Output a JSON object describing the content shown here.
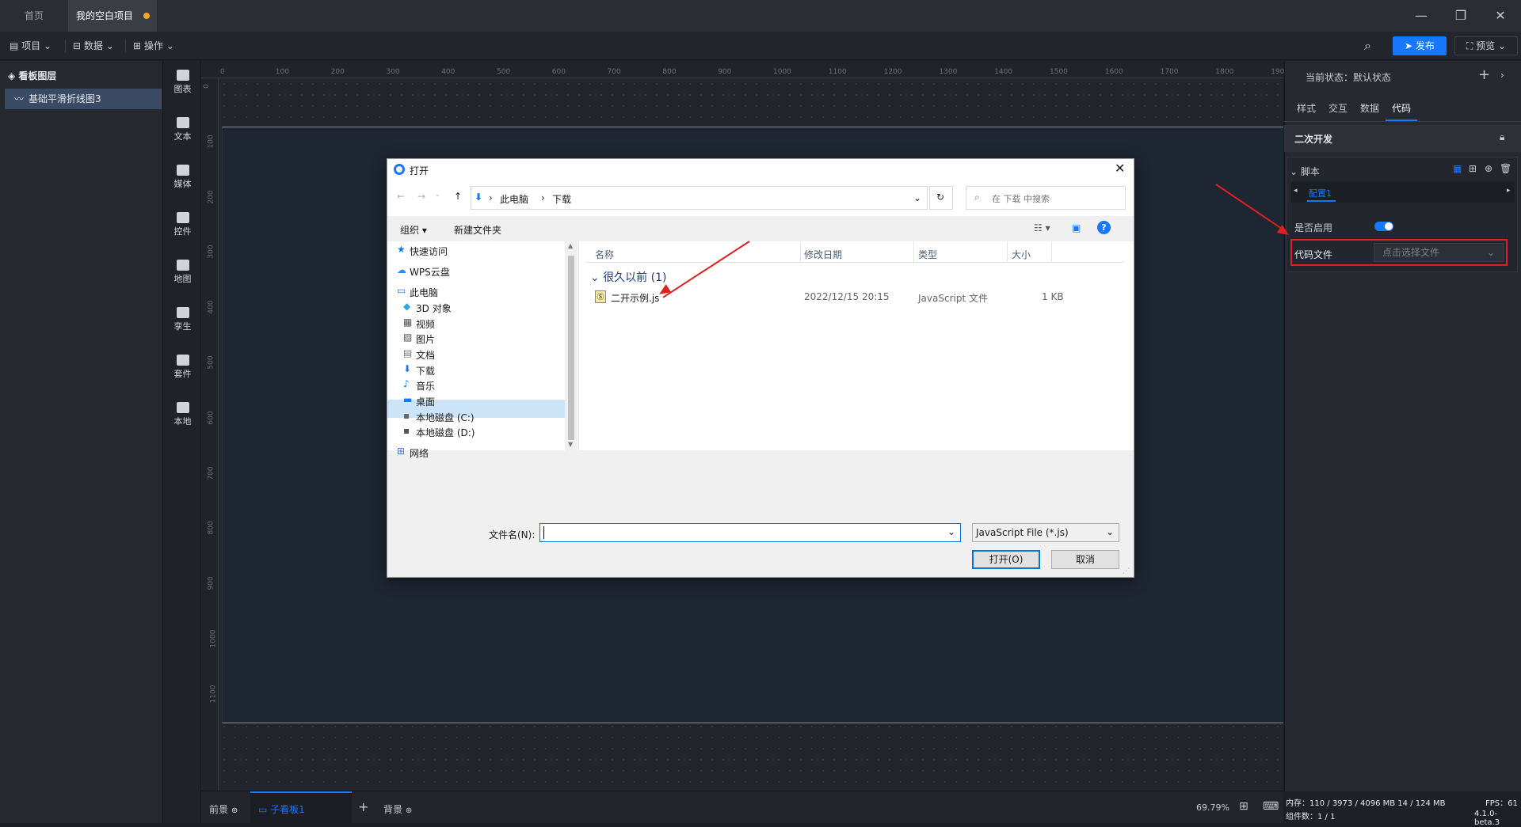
{
  "tabs": [
    {
      "label": "首页"
    },
    {
      "label": "我的空白项目"
    }
  ],
  "window_controls": {
    "minimize": "—",
    "restore": "❐",
    "close": "✕"
  },
  "menu": {
    "project": "项目",
    "data": "数据",
    "operate": "操作"
  },
  "header": {
    "publish": "发布",
    "preview": "预览"
  },
  "layers": {
    "title": "看板图层",
    "items": [
      {
        "label": "基础平滑折线图3"
      }
    ]
  },
  "rail": [
    {
      "label": "图表",
      "icon": "chart-icon"
    },
    {
      "label": "文本",
      "icon": "text-icon"
    },
    {
      "label": "媒体",
      "icon": "media-icon"
    },
    {
      "label": "控件",
      "icon": "control-icon"
    },
    {
      "label": "地图",
      "icon": "map-icon"
    },
    {
      "label": "孪生",
      "icon": "twin-icon"
    },
    {
      "label": "套件",
      "icon": "kit-icon"
    },
    {
      "label": "本地",
      "icon": "local-icon"
    }
  ],
  "ruler": {
    "h_ticks": [
      "0",
      "100",
      "200",
      "300",
      "400",
      "500",
      "600",
      "700",
      "800",
      "900",
      "1000",
      "1100",
      "1200",
      "1300",
      "1400",
      "1500",
      "1600",
      "1700",
      "1800",
      "1900"
    ],
    "v_ticks": [
      "0",
      "100",
      "200",
      "300",
      "400",
      "500",
      "600",
      "700",
      "800",
      "900",
      "1000",
      "1100"
    ]
  },
  "bottom": {
    "front": "前景",
    "sub_board": "子看板1",
    "background": "背景",
    "zoom": "69.79%"
  },
  "right_panel": {
    "state_label": "当前状态：",
    "state_value": "默认状态",
    "tabs": [
      "样式",
      "交互",
      "数据",
      "代码"
    ],
    "active_tab": "代码",
    "section": "二次开发",
    "script_title": "脚本",
    "config_tab": "配置1",
    "enable_label": "是否启用",
    "enabled": true,
    "code_file_label": "代码文件",
    "code_file_placeholder": "点击选择文件"
  },
  "status": {
    "memory_label": "内存：",
    "memory": "110 / 3973 / 4096 MB 14 / 124 MB",
    "fps_label": "FPS：",
    "fps": "61",
    "components_label": "组件数：",
    "components": "1 / 1",
    "version": "4.1.0-beta.3"
  },
  "dialog": {
    "title": "打开",
    "path": [
      "此电脑",
      "下载"
    ],
    "search_placeholder": "在 下载 中搜索",
    "organize": "组织",
    "new_folder": "新建文件夹",
    "nav": [
      {
        "label": "快速访问",
        "icon": "star-icon"
      },
      {
        "label": "WPS云盘",
        "icon": "cloud-icon"
      },
      {
        "label": "此电脑",
        "icon": "pc-icon"
      },
      {
        "label": "3D 对象",
        "icon": "cube-icon"
      },
      {
        "label": "视频",
        "icon": "video-icon"
      },
      {
        "label": "图片",
        "icon": "picture-icon"
      },
      {
        "label": "文档",
        "icon": "document-icon"
      },
      {
        "label": "下载",
        "icon": "download-icon"
      },
      {
        "label": "音乐",
        "icon": "music-icon"
      },
      {
        "label": "桌面",
        "icon": "desktop-icon"
      },
      {
        "label": "本地磁盘 (C:)",
        "icon": "disk-icon"
      },
      {
        "label": "本地磁盘 (D:)",
        "icon": "disk-icon"
      },
      {
        "label": "网络",
        "icon": "network-icon"
      }
    ],
    "columns": [
      "名称",
      "修改日期",
      "类型",
      "大小"
    ],
    "group": "很久以前 (1)",
    "files": [
      {
        "name": "二开示例.js",
        "date": "2022/12/15 20:15",
        "type": "JavaScript 文件",
        "size": "1 KB"
      }
    ],
    "filename_label": "文件名(N):",
    "filename_value": "",
    "filetype": "JavaScript File (*.js)",
    "open": "打开(O)",
    "cancel": "取消"
  },
  "colors": {
    "accent": "#1677ff",
    "annotation": "#e02020",
    "modified_dot": "#f5a623"
  }
}
